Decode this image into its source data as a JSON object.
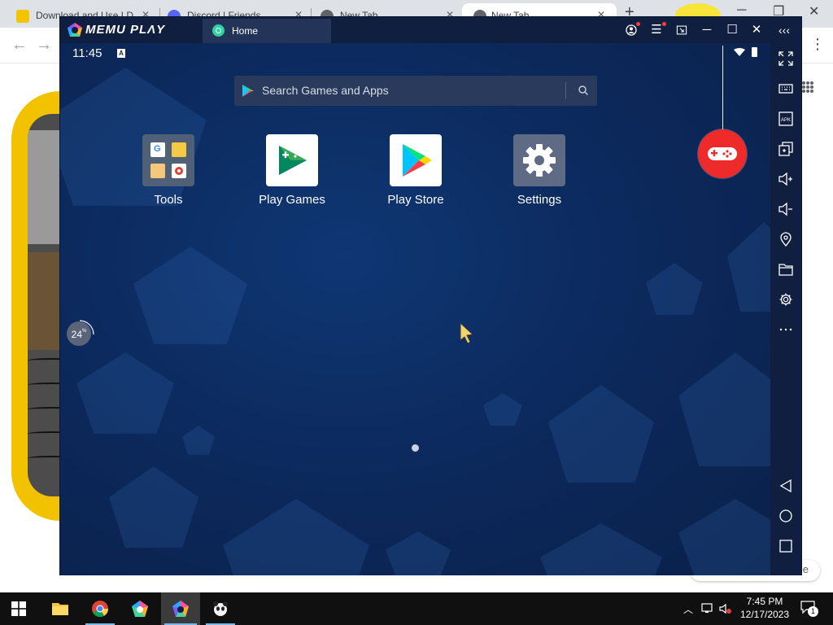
{
  "browser": {
    "tabs": [
      {
        "title": "Download and Use LD",
        "favicon": "ld-player-icon",
        "active": false
      },
      {
        "title": "Discord | Friends",
        "favicon": "discord-icon",
        "active": false
      },
      {
        "title": "New Tab",
        "favicon": "chrome-icon",
        "active": false
      },
      {
        "title": "New Tab",
        "favicon": "chrome-icon",
        "active": true
      }
    ],
    "new_tab": "+",
    "close_glyph": "✕"
  },
  "emulator": {
    "brand": "MEMU PLΛY",
    "tab_label": "Home",
    "status": {
      "time": "11:45",
      "notification_badge": "A"
    },
    "search": {
      "placeholder": "Search Games and Apps",
      "value": ""
    },
    "apps": [
      {
        "label": "Tools",
        "icon": "tools-folder-icon"
      },
      {
        "label": "Play Games",
        "icon": "play-games-icon"
      },
      {
        "label": "Play Store",
        "icon": "play-store-icon"
      },
      {
        "label": "Settings",
        "icon": "settings-gear-icon"
      }
    ],
    "loading_percent": "24",
    "loading_unit": "%",
    "page_indicator": {
      "pages": 1,
      "current": 1
    },
    "sidebar_tools": [
      "fullscreen-icon",
      "keyboard-icon",
      "apk-install-icon",
      "multi-instance-icon",
      "volume-up-icon",
      "volume-down-icon",
      "location-icon",
      "folder-icon",
      "settings-icon",
      "more-icon",
      "back-icon",
      "home-icon",
      "recents-icon"
    ],
    "apk_label": "APK"
  },
  "taskbar": {
    "apps": [
      "file-explorer-icon",
      "chrome-icon",
      "memu-multi-icon",
      "memu-icon",
      "panda-app-icon"
    ],
    "clock_time": "7:45 PM",
    "clock_date": "12/17/2023",
    "notification_count": "1"
  },
  "colors": {
    "emulator_bg": "#0c2350",
    "accent_red": "#ee2a2a",
    "taskbar": "#101010"
  }
}
